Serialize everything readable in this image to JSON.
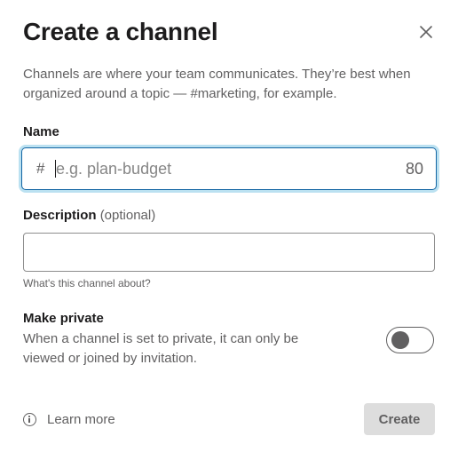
{
  "dialog": {
    "title": "Create a channel",
    "close_icon": "close-icon",
    "intro": "Channels are where your team communicates. They’re best when organized around a topic — #marketing, for example."
  },
  "name": {
    "label": "Name",
    "prefix": "#",
    "placeholder": "e.g. plan-budget",
    "value": "",
    "remaining": "80"
  },
  "description": {
    "label": "Description",
    "optional": "(optional)",
    "value": "",
    "hint": "What's this channel about?"
  },
  "private": {
    "label": "Make private",
    "description": "When a channel is set to private, it can only be viewed or joined by invitation.",
    "enabled": false
  },
  "footer": {
    "learn_more": "Learn more",
    "info_icon": "info-icon",
    "create_label": "Create"
  },
  "colors": {
    "focus_border": "#1264a3",
    "button_disabled_bg": "#dddddd",
    "text_muted": "#616061"
  }
}
